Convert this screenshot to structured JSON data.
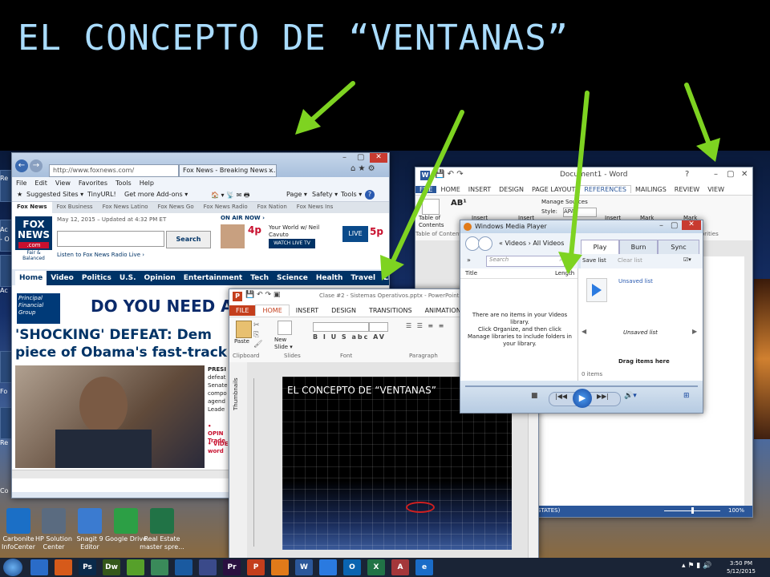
{
  "slide": {
    "title": "EL CONCEPTO DE “VENTANAS”"
  },
  "desktop": {
    "left_labels": [
      "Re",
      "Ac",
      "- O",
      "Ac",
      "Fo",
      "Re",
      "Co"
    ],
    "icons": [
      {
        "label": "Carbonite InfoCenter",
        "color": "#1b6fc6"
      },
      {
        "label": "HP Solution Center",
        "color": "#5a6b80"
      },
      {
        "label": "Snagit 9 Editor",
        "color": "#3b7bd0"
      },
      {
        "label": "Google Drive",
        "color": "#2c9f45"
      },
      {
        "label": "Real Estate master spre...",
        "color": "#217346"
      }
    ]
  },
  "ie": {
    "url": "http://www.foxnews.com/",
    "tab_label": "Fox News - Breaking News ...",
    "menu": [
      "File",
      "Edit",
      "View",
      "Favorites",
      "Tools",
      "Help"
    ],
    "favorites": [
      "Suggested Sites ▾",
      "TinyURL!",
      "Get more Add-ons ▾"
    ],
    "command": [
      "Page ▾",
      "Safety ▾",
      "Tools ▾"
    ],
    "sites": [
      "Fox News",
      "Fox Business",
      "Fox News Latino",
      "Fox News Go",
      "Fox News Radio",
      "Fox Nation",
      "Fox News Ins"
    ],
    "date": "May 12, 2015 – Updated at 4:32 PM ET",
    "search_label": "Search",
    "radio": "Listen to Fox News Radio Live ›",
    "logo_main": "FOX NEWS",
    "logo_sub": ".com",
    "logo_tag": "Fair & Balanced",
    "on_air_label": "ON AIR NOW ›",
    "on_air_time": "4p",
    "on_air_show": "Your World w/ Neil Cavuto",
    "watch_live": "WATCH LIVE TV",
    "live_badge": "LIVE",
    "on_air_time2": "5p",
    "nav": [
      "Home",
      "Video",
      "Politics",
      "U.S.",
      "Opinion",
      "Entertainment",
      "Tech",
      "Science",
      "Health",
      "Travel",
      "Lifestyle"
    ],
    "ad_brand": "Principal Financial Group",
    "ad_text": "DO YOU NEED A FIN",
    "headline1": "'SHOCKING' DEFEAT: Dem",
    "headline2": "piece of Obama's fast-track",
    "side_text": [
      "PRESI",
      "defeat",
      "Senate",
      "compo",
      "agend",
      "Leade"
    ],
    "bullets": [
      "• OPIN Trade",
      "• VIDE word"
    ]
  },
  "word": {
    "title": "Document1 - Word",
    "tabs": [
      "FILE",
      "HOME",
      "INSERT",
      "DESIGN",
      "PAGE LAYOUT",
      "REFERENCES",
      "MAILINGS",
      "REVIEW",
      "VIEW"
    ],
    "groups": [
      "Table of Contents",
      "Insert",
      "Insert",
      "Insert",
      "Mark",
      "Mark"
    ],
    "group_label": "Table of Content",
    "manage_sources": "Manage Sources",
    "style_label": "Style:",
    "style_value": "APA",
    "right_label": "orities",
    "status": "STATES)",
    "zoom": "100%"
  },
  "ppt": {
    "title": "Clase #2 - Sistemas Operativos.pptx - PowerPoint",
    "tabs": [
      "FILE",
      "HOME",
      "INSERT",
      "DESIGN",
      "TRANSITIONS",
      "ANIMATIONS"
    ],
    "paste": "Paste",
    "new_slide": "New Slide ▾",
    "groups": [
      "Clipboard",
      "Slides",
      "Font",
      "Paragraph"
    ],
    "thumbnails": "Thumbnails",
    "slide_text": "EL CONCEPTO DE “VENTANAS”"
  },
  "wmp": {
    "title": "Windows Media Player",
    "breadcrumb": [
      "Videos",
      "All Videos"
    ],
    "tabs": [
      "Play",
      "Burn",
      "Sync"
    ],
    "search_placeholder": "Search",
    "save_list": "Save list",
    "clear_list": "Clear list",
    "col_title": "Title",
    "col_length": "Length",
    "empty_message": "There are no items in your Videos library.\nClick Organize, and then click Manage libraries to include folders in your library.",
    "unsaved_list": "Unsaved list",
    "unsaved_list_center": "Unsaved list",
    "drag_here": "Drag items here",
    "items_count": "0 items"
  },
  "taskbar": {
    "apps": [
      {
        "label": "",
        "color": "#2a6cc8"
      },
      {
        "label": "",
        "color": "#d65a1a"
      },
      {
        "label": "Ps",
        "color": "#0a2a4a"
      },
      {
        "label": "Dw",
        "color": "#35581a"
      },
      {
        "label": "",
        "color": "#56a02a"
      },
      {
        "label": "",
        "color": "#3a8a5a"
      },
      {
        "label": "",
        "color": "#1a5aa0"
      },
      {
        "label": "",
        "color": "#3a4a8a"
      },
      {
        "label": "Pr",
        "color": "#2a1040"
      },
      {
        "label": "P",
        "color": "#c43e1c"
      },
      {
        "label": "",
        "color": "#e07a1a"
      },
      {
        "label": "W",
        "color": "#2b579a"
      },
      {
        "label": "",
        "color": "#2a7ae0"
      },
      {
        "label": "O",
        "color": "#0a64b0"
      },
      {
        "label": "X",
        "color": "#217346"
      },
      {
        "label": "A",
        "color": "#a4373a"
      },
      {
        "label": "e",
        "color": "#1a6cc8"
      }
    ],
    "time": "3:50 PM",
    "date": "5/12/2015"
  },
  "colors": {
    "arrow": "#7ed321",
    "fox_red": "#c8102e",
    "fox_blue": "#003366"
  }
}
